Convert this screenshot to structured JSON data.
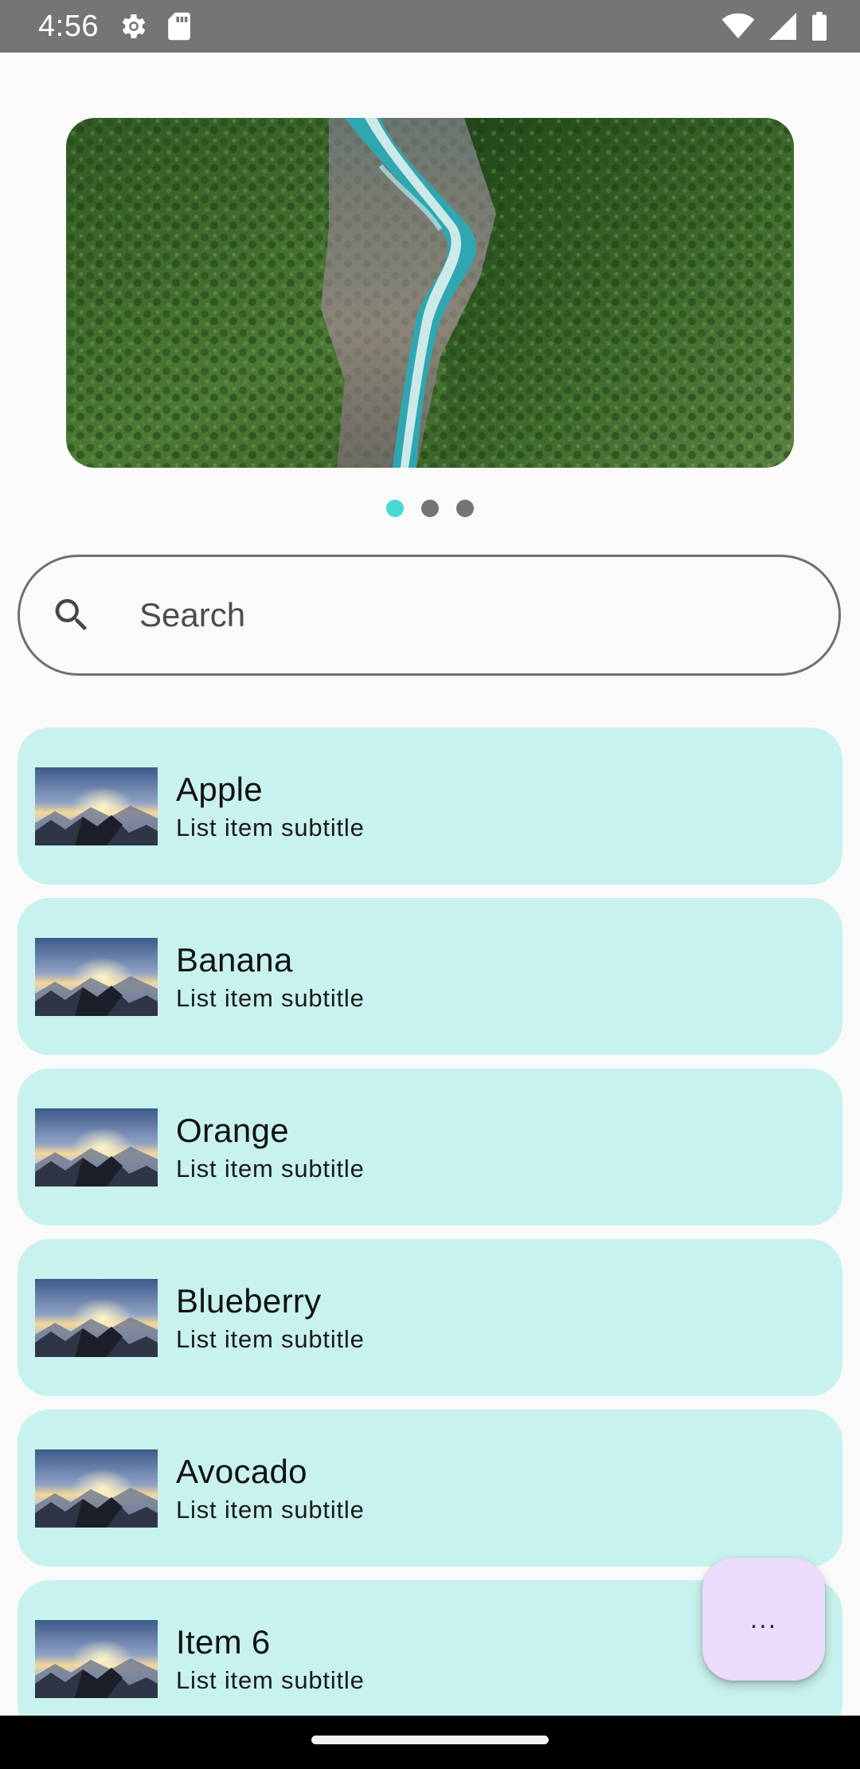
{
  "status_bar": {
    "time": "4:56",
    "icons": [
      "settings-icon",
      "sd-card-icon",
      "wifi-icon",
      "signal-icon",
      "battery-icon"
    ]
  },
  "carousel": {
    "image": "river-forest-aerial",
    "page_count": 3,
    "active_index": 0,
    "active_color": "#48d9d2",
    "inactive_color": "#757575"
  },
  "search": {
    "placeholder": "Search",
    "value": ""
  },
  "list": {
    "item_background": "#c8f2ed",
    "items": [
      {
        "title": "Apple",
        "subtitle": "List item subtitle",
        "thumbnail": "mountain-sunset"
      },
      {
        "title": "Banana",
        "subtitle": "List item subtitle",
        "thumbnail": "mountain-sunset"
      },
      {
        "title": "Orange",
        "subtitle": "List item subtitle",
        "thumbnail": "mountain-sunset"
      },
      {
        "title": "Blueberry",
        "subtitle": "List item subtitle",
        "thumbnail": "mountain-sunset"
      },
      {
        "title": "Avocado",
        "subtitle": "List item subtitle",
        "thumbnail": "mountain-sunset"
      },
      {
        "title": "Item 6",
        "subtitle": "List item subtitle",
        "thumbnail": "mountain-sunset"
      }
    ]
  },
  "fab": {
    "label": "...",
    "background": "#ebdcfb"
  }
}
